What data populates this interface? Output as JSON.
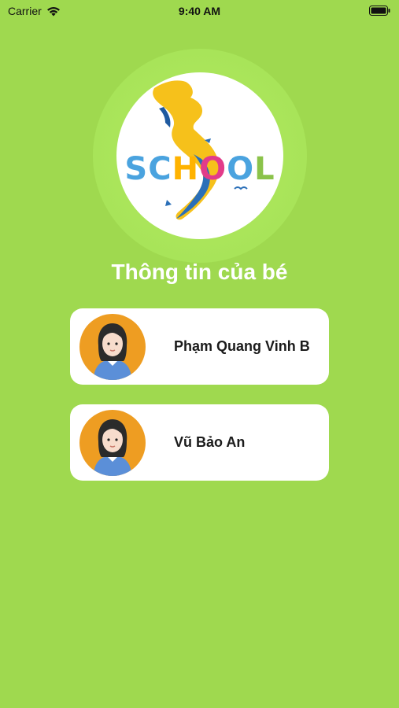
{
  "status_bar": {
    "carrier": "Carrier",
    "time": "9:40 AM"
  },
  "logo": {
    "letters": [
      "S",
      "C",
      "H",
      "O",
      "O",
      "L"
    ],
    "letter_colors": [
      "#4aa3df",
      "#4aa3df",
      "#ffb300",
      "#e23b8a",
      "#4aa3df",
      "#8bc34a"
    ]
  },
  "page": {
    "title": "Thông tin của bé"
  },
  "children": [
    {
      "name": "Phạm Quang Vinh B",
      "avatar_icon": "child-avatar-icon"
    },
    {
      "name": "Vũ Bảo An",
      "avatar_icon": "child-avatar-icon"
    }
  ],
  "colors": {
    "background": "#9fd94f",
    "card": "#ffffff",
    "avatar_bg": "#ee9d22"
  }
}
